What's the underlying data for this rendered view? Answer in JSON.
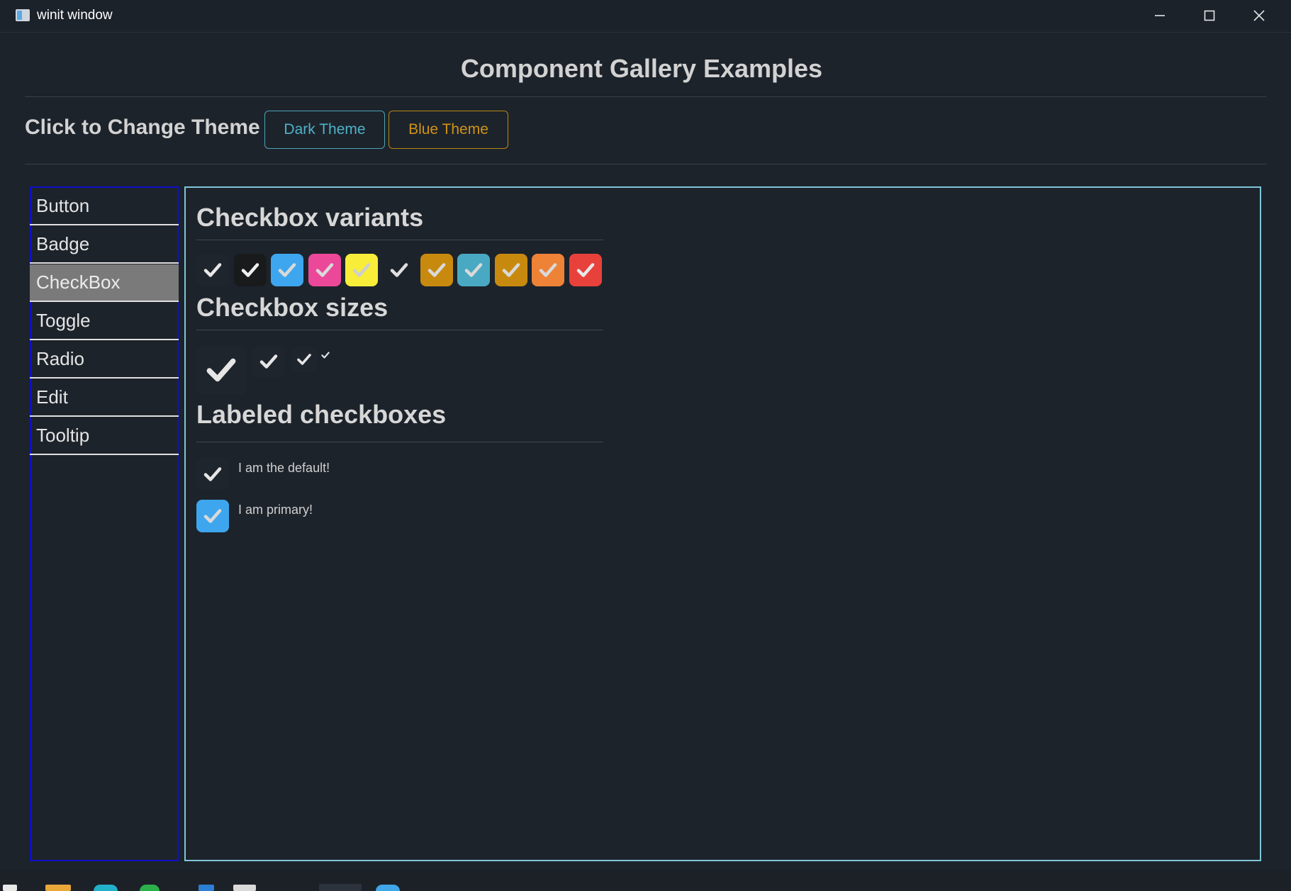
{
  "window": {
    "title": "winit window",
    "controls": [
      "minimize-icon",
      "maximize-icon",
      "close-icon"
    ]
  },
  "page": {
    "title": "Component Gallery Examples",
    "theme_label": "Click to Change Theme",
    "theme_buttons": [
      {
        "label": "Dark Theme",
        "color": "#4fb1c8"
      },
      {
        "label": "Blue Theme",
        "color": "#cf9316"
      }
    ]
  },
  "sidebar": {
    "items": [
      {
        "label": "Button",
        "active": false
      },
      {
        "label": "Badge",
        "active": false
      },
      {
        "label": "CheckBox",
        "active": true
      },
      {
        "label": "Toggle",
        "active": false
      },
      {
        "label": "Radio",
        "active": false
      },
      {
        "label": "Edit",
        "active": false
      },
      {
        "label": "Tooltip",
        "active": false
      }
    ]
  },
  "panel": {
    "variants": {
      "title": "Checkbox variants",
      "items": [
        {
          "bg": "#1f252c",
          "check": "#e8e8e8"
        },
        {
          "bg": "#191a1c",
          "check": "#f0f0f0"
        },
        {
          "bg": "#3ea6ee",
          "check": "#d9d9d9"
        },
        {
          "bg": "#ec4899",
          "check": "#d9d9d9"
        },
        {
          "bg": "#f8ee3a",
          "check": "#cfcfcf"
        },
        {
          "bg": "#1d232b",
          "check": "#e0e0e0"
        },
        {
          "bg": "#c88a0e",
          "check": "#d9d9d9"
        },
        {
          "bg": "#49a9c2",
          "check": "#d9d9d9"
        },
        {
          "bg": "#c88a0e",
          "check": "#d9d9d9"
        },
        {
          "bg": "#ee8236",
          "check": "#d9d9d9"
        },
        {
          "bg": "#e8413b",
          "check": "#e8e8e8"
        }
      ]
    },
    "sizes": {
      "title": "Checkbox sizes",
      "items": [
        "large",
        "medium",
        "small",
        "tiny"
      ]
    },
    "labeled": {
      "title": "Labeled checkboxes",
      "items": [
        {
          "label": "I am the default!",
          "bg": "#1f252c"
        },
        {
          "label": "I am primary!",
          "bg": "#3ea6ee"
        }
      ]
    }
  }
}
